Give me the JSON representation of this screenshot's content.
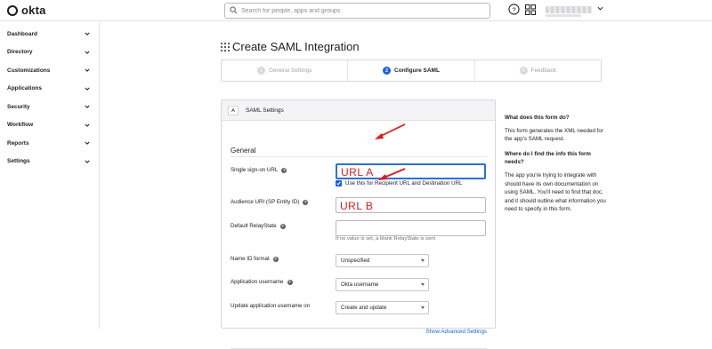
{
  "app": {
    "name": "okta"
  },
  "search": {
    "placeholder": "Search for people, apps and groups"
  },
  "sidebar": {
    "items": [
      {
        "label": "Dashboard"
      },
      {
        "label": "Directory"
      },
      {
        "label": "Customizations"
      },
      {
        "label": "Applications"
      },
      {
        "label": "Security"
      },
      {
        "label": "Workflow"
      },
      {
        "label": "Reports"
      },
      {
        "label": "Settings"
      }
    ]
  },
  "page": {
    "title": "Create SAML Integration"
  },
  "stepper": {
    "steps": [
      {
        "num": "1",
        "label": "General Settings",
        "active": false
      },
      {
        "num": "2",
        "label": "Configure SAML",
        "active": true
      },
      {
        "num": "3",
        "label": "Feedback",
        "active": false
      }
    ]
  },
  "card": {
    "badge": "A",
    "title": "SAML Settings",
    "section": "General",
    "fields": {
      "sso_url": {
        "label": "Single sign-on URL",
        "value": "URL A"
      },
      "recipient_checkbox": {
        "label": "Use this for Recipient URL and Destination URL",
        "checked": true
      },
      "audience_uri": {
        "label": "Audience URI (SP Entity ID)",
        "value": "URL B"
      },
      "relay_state": {
        "label": "Default RelayState",
        "value": "",
        "hint": "If no value is set, a blank RelayState is sent"
      },
      "name_id_format": {
        "label": "Name ID format",
        "selected": "Unspecified"
      },
      "app_username": {
        "label": "Application username",
        "selected": "Okta username"
      },
      "update_username": {
        "label": "Update application username on",
        "selected": "Create and update"
      }
    },
    "advanced_link": "Show Advanced Settings"
  },
  "help": {
    "q1": "What does this form do?",
    "a1": "This form generates the XML needed for the app's SAML request.",
    "q2": "Where do I find the info this form needs?",
    "a2": "The app you're trying to integrate with should have its own documentation on using SAML. You'll need to find that doc, and it should outline what information you need to specify in this form."
  },
  "colors": {
    "accent": "#1662dd",
    "annotation": "#e0191b"
  }
}
